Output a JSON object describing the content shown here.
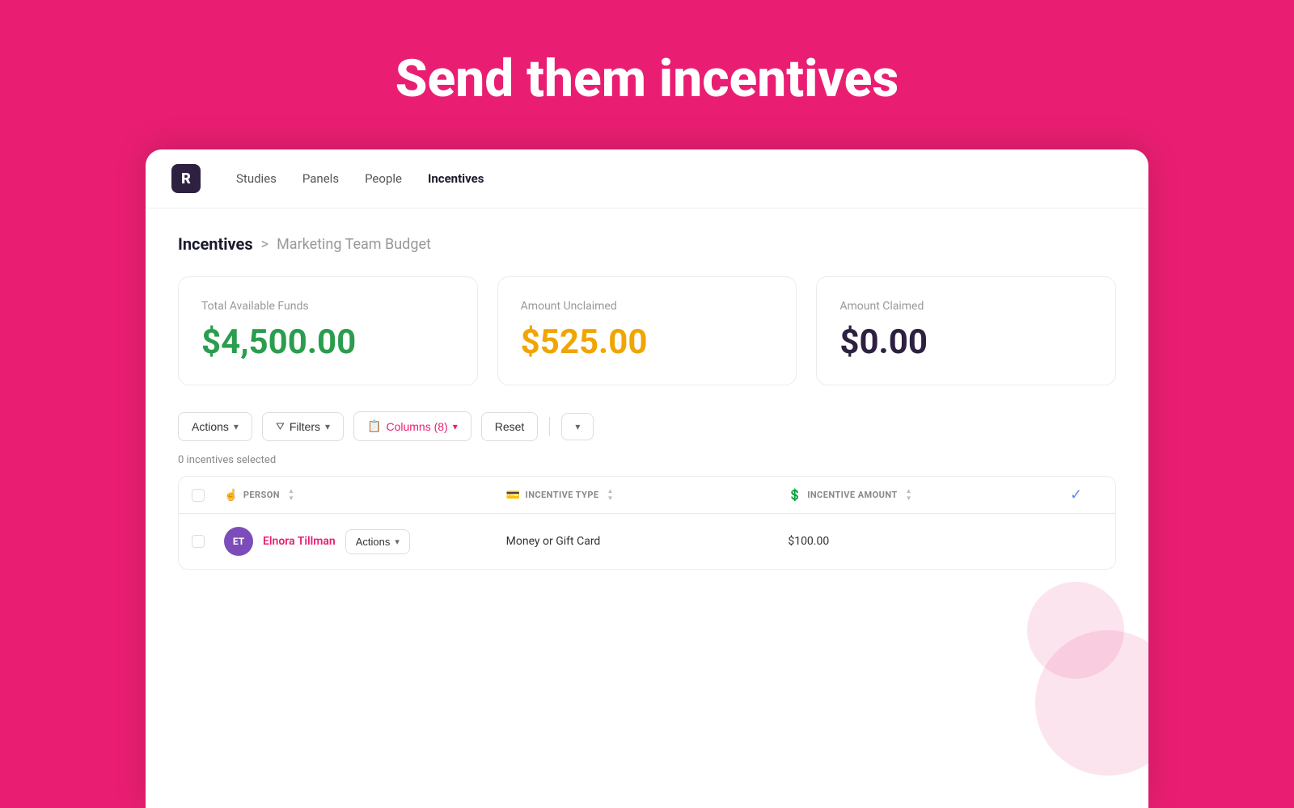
{
  "hero": {
    "title": "Send them incentives"
  },
  "nav": {
    "logo": "R",
    "items": [
      {
        "label": "Studies",
        "active": false
      },
      {
        "label": "Panels",
        "active": false
      },
      {
        "label": "People",
        "active": false
      },
      {
        "label": "Incentives",
        "active": true
      }
    ]
  },
  "breadcrumb": {
    "home": "Incentives",
    "separator": ">",
    "current": "Marketing Team Budget"
  },
  "stats": [
    {
      "label": "Total Available Funds",
      "value": "$4,500.00",
      "color": "green"
    },
    {
      "label": "Amount Unclaimed",
      "value": "$525.00",
      "color": "orange"
    },
    {
      "label": "Amount Claimed",
      "value": "$0.00",
      "color": "dark"
    }
  ],
  "toolbar": {
    "actions_label": "Actions",
    "filters_label": "Filters",
    "columns_label": "Columns (8)",
    "reset_label": "Reset"
  },
  "selected_count": "0 incentives selected",
  "table": {
    "headers": [
      {
        "icon": "👤",
        "label": "PERSON"
      },
      {
        "icon": "💳",
        "label": "INCENTIVE TYPE"
      },
      {
        "icon": "💲",
        "label": "INCENTIVE AMOUNT"
      }
    ],
    "rows": [
      {
        "initials": "ET",
        "avatar_color": "#7c4dba",
        "name": "Elnora Tillman",
        "actions_label": "Actions",
        "incentive_type": "Money or Gift Card",
        "incentive_amount": "$100.00"
      }
    ]
  }
}
